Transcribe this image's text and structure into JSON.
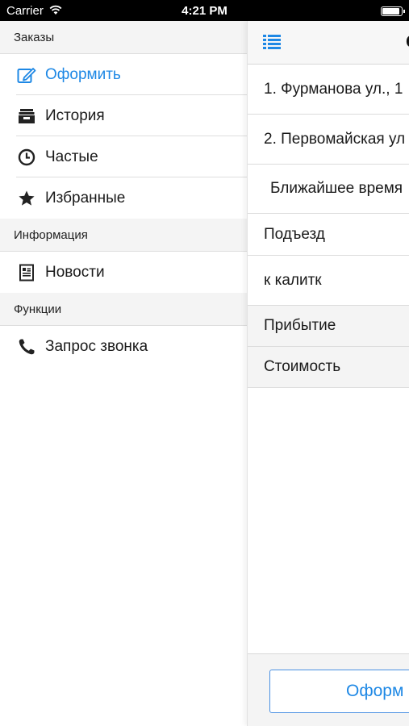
{
  "status_bar": {
    "carrier": "Carrier",
    "time": "4:21 PM"
  },
  "menu": {
    "sections": [
      {
        "header": "Заказы",
        "items": [
          {
            "label": "Оформить",
            "icon": "compose-icon",
            "active": true
          },
          {
            "label": "История",
            "icon": "archive-box-icon"
          },
          {
            "label": "Частые",
            "icon": "clock-icon"
          },
          {
            "label": "Избранные",
            "icon": "star-icon"
          }
        ]
      },
      {
        "header": "Информация",
        "items": [
          {
            "label": "Новости",
            "icon": "news-icon"
          }
        ]
      },
      {
        "header": "Функции",
        "items": [
          {
            "label": "Запрос звонка",
            "icon": "phone-icon"
          }
        ]
      }
    ]
  },
  "order": {
    "title_peek": "О",
    "rows": [
      "1. Фурманова ул., 1",
      "2. Первомайская ул",
      "Ближайшее время",
      "Подъезд",
      "к калитк",
      "Прибытие",
      "Стоимость"
    ],
    "submit_label": "Оформ"
  },
  "colors": {
    "accent": "#1e88e5",
    "section_bg": "#f4f4f4",
    "separator": "#dedede"
  }
}
